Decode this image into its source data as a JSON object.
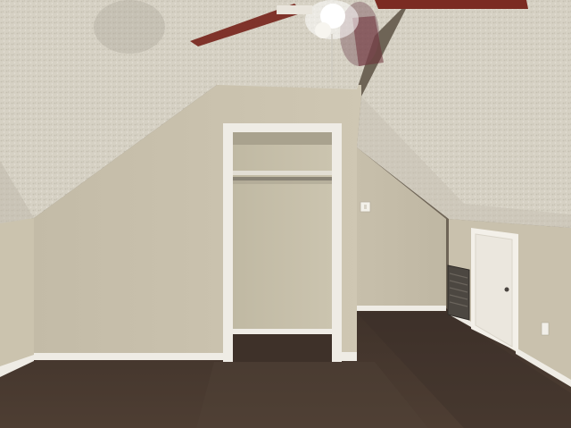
{
  "scene": {
    "description_tags": [
      "attic-bedroom",
      "sloped-ceiling",
      "ceiling-fan",
      "open-closet",
      "carpet-floor",
      "hvac-vent",
      "white-door"
    ],
    "colors": {
      "ceiling": "#d9d4c7",
      "wall": "#cfc6b2",
      "wall_shadow": "#b9b09c",
      "trim": "#f1efe9",
      "carpet": "#4a3b31",
      "carpet_dark": "#3a2d25",
      "fan_blade": "#7a2a22",
      "vent": "#4f4a44",
      "door": "#ece8df"
    }
  }
}
